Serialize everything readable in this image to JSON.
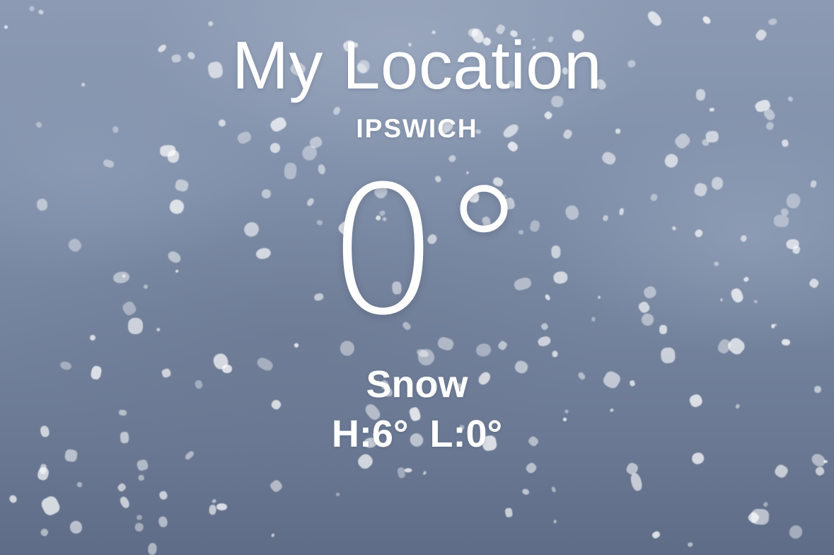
{
  "location": {
    "title": "My Location",
    "city": "IPSWICH"
  },
  "current": {
    "temperature": "0°",
    "condition": "Snow",
    "high": "H:6°",
    "low": "L:0°"
  },
  "background": {
    "scene": "snowfall",
    "sky_top_color": "#8c9ab3",
    "sky_bottom_color": "#5f6c87"
  }
}
